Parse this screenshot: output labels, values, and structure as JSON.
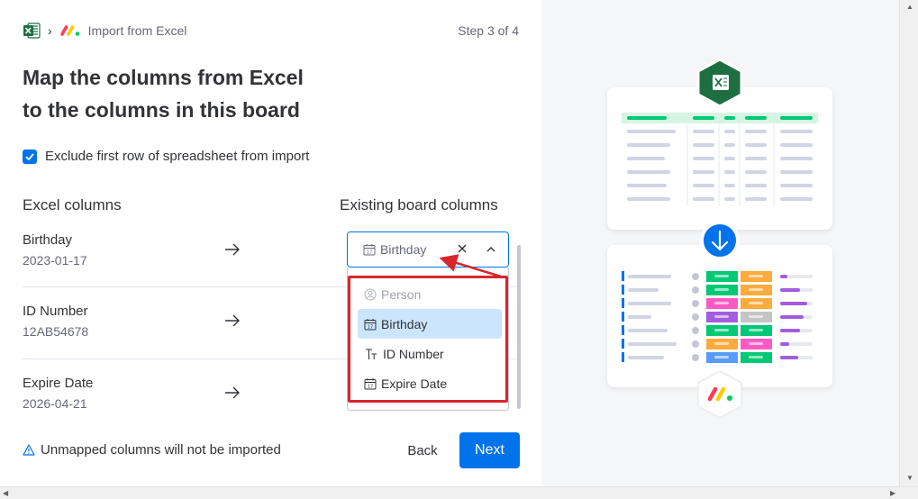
{
  "breadcrumb": {
    "title": "Import from Excel"
  },
  "step": "Step 3 of 4",
  "heading": {
    "line1": "Map the columns from Excel",
    "line2": "to the columns in this board"
  },
  "exclude_checkbox": {
    "label": "Exclude first row of spreadsheet from import",
    "checked": true
  },
  "columns_header": {
    "excel": "Excel columns",
    "board": "Existing board columns"
  },
  "rows": [
    {
      "name": "Birthday",
      "sample": "2023-01-17"
    },
    {
      "name": "ID Number",
      "sample": "12AB54678"
    },
    {
      "name": "Expire Date",
      "sample": "2026-04-21"
    }
  ],
  "select": {
    "value": "Birthday"
  },
  "dropdown": {
    "items": [
      {
        "label": "Person",
        "icon": "person-icon",
        "disabled": true
      },
      {
        "label": "Birthday",
        "icon": "calendar-icon",
        "selected": true
      },
      {
        "label": "ID Number",
        "icon": "text-icon"
      },
      {
        "label": "Expire Date",
        "icon": "calendar-icon"
      }
    ]
  },
  "footer": {
    "warning": "Unmapped columns will not be imported",
    "back_label": "Back",
    "next_label": "Next"
  },
  "colors": {
    "primary": "#0073ea",
    "highlight": "#cce5ff",
    "annotation": "#d9262c",
    "excel_green": "#1d6f42",
    "status_green": "#00c875",
    "status_orange": "#fdab3d",
    "status_pink": "#ff5ac4",
    "status_purple": "#a25ddc",
    "status_blue": "#579bfc"
  }
}
